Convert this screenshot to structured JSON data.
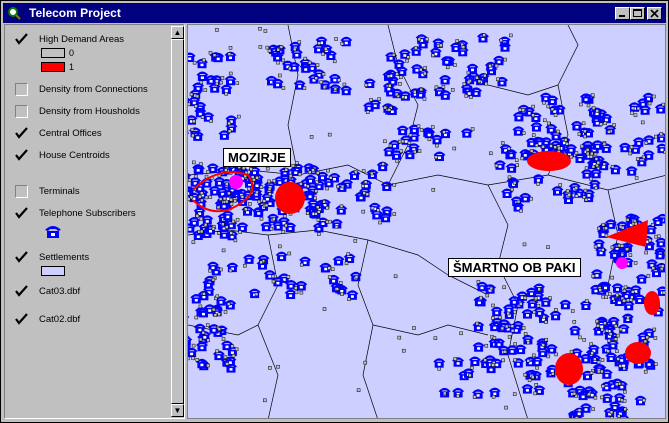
{
  "window": {
    "title": "Telecom Project"
  },
  "toc": {
    "layers": [
      {
        "name": "High Demand Areas",
        "checked": true
      },
      {
        "name": "Density from Connections",
        "checked": false
      },
      {
        "name": "Density from Housholds",
        "checked": false
      },
      {
        "name": "Central Offices",
        "checked": true
      },
      {
        "name": "House Centroids",
        "checked": true
      },
      {
        "name": "Terminals",
        "checked": false
      },
      {
        "name": "Telephone Subscribers",
        "checked": true
      },
      {
        "name": "Settlements",
        "checked": true
      },
      {
        "name": "Cat03.dbf",
        "checked": true
      },
      {
        "name": "Cat02.dbf",
        "checked": true
      }
    ],
    "legend_high_demand": [
      {
        "label": "0",
        "color": "#c0c0c0"
      },
      {
        "label": "1",
        "color": "#ff0000"
      }
    ],
    "settlements_color": "#cccfff",
    "subscriber_icon": "telephone-icon"
  },
  "map": {
    "labels": [
      {
        "text": "MOZIRJE"
      },
      {
        "text": "ŠMARTNO OB PAKI"
      }
    ],
    "colors": {
      "background": "#cccfff",
      "subscribers": "#0000ff",
      "demand": "#ff0000",
      "office": "#ff00ff"
    }
  }
}
